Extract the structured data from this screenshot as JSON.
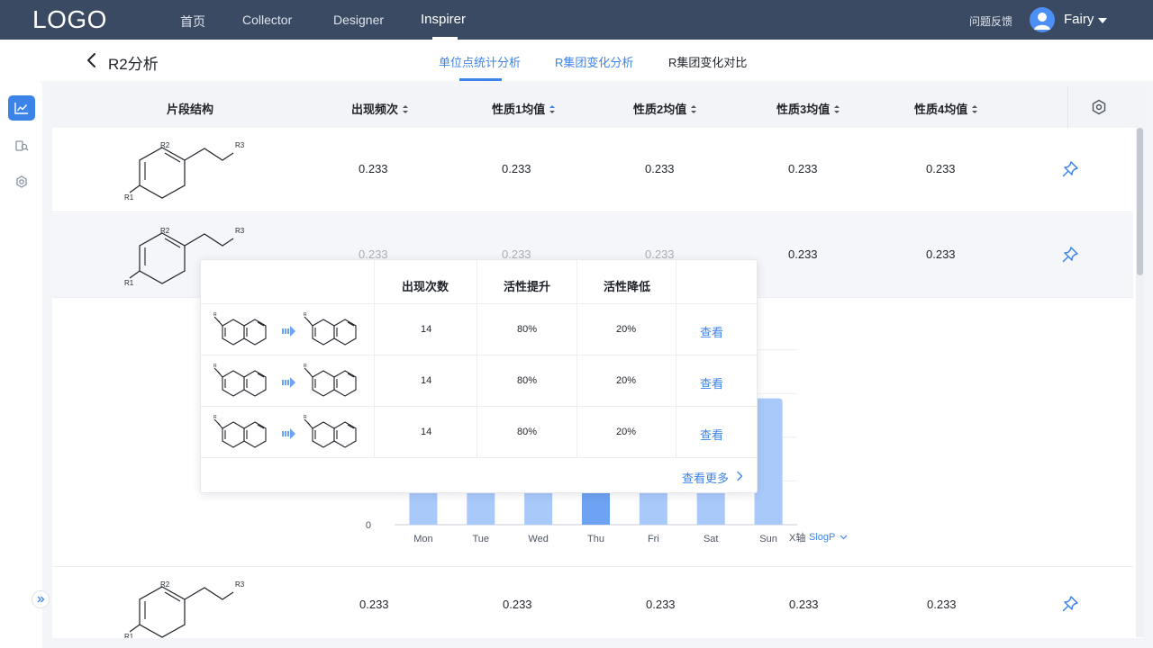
{
  "topnav": {
    "logo": "LOGO",
    "items": [
      "首页",
      "Collector",
      "Designer",
      "Inspirer"
    ],
    "active_index": 3,
    "feedback": "问题反馈",
    "user": "Fairy"
  },
  "subheader": {
    "title": "R2分析",
    "tabs": [
      "单位点统计分析",
      "R集团变化分析",
      "R集团变化对比"
    ],
    "active_tab": 0
  },
  "table": {
    "headers": [
      "片段结构",
      "出现频次",
      "性质1均值",
      "性质2均值",
      "性质3均值",
      "性质4均值"
    ],
    "rows": [
      {
        "structure_labels": [
          "R1",
          "R2",
          "R3"
        ],
        "values": [
          "0.233",
          "0.233",
          "0.233",
          "0.233",
          "0.233"
        ]
      },
      {
        "structure_labels": [
          "R1",
          "R2",
          "R3"
        ],
        "values": [
          "0.233",
          "0.233",
          "0.233",
          "0.233",
          "0.233"
        ]
      },
      {
        "structure_labels": [
          "R1",
          "R2",
          "R3"
        ],
        "values": [
          "0.233",
          "0.233",
          "0.233",
          "0.233",
          "0.233"
        ]
      }
    ]
  },
  "popup": {
    "headers": [
      "出现次数",
      "活性提升",
      "活性降低"
    ],
    "rows": [
      {
        "count": "14",
        "up": "80%",
        "down": "20%",
        "action": "查看"
      },
      {
        "count": "14",
        "up": "80%",
        "down": "20%",
        "action": "查看"
      },
      {
        "count": "14",
        "up": "80%",
        "down": "20%",
        "action": "查看"
      }
    ],
    "more": "查看更多"
  },
  "chart_data": {
    "type": "bar",
    "categories": [
      "Mon",
      "Tue",
      "Wed",
      "Thu",
      "Fri",
      "Sat",
      "Sun"
    ],
    "values": [
      420,
      390,
      360,
      120,
      390,
      400,
      260
    ],
    "ylim": [
      0,
      450
    ],
    "y_tick_label": "0",
    "x_axis_prefix": "X轴",
    "x_axis_selector": "SlogP",
    "highlight_index": 3,
    "colors": {
      "bar": "#a9c9fb",
      "bar_highlight": "#6ea2f3",
      "accent": "#3d84e8"
    }
  },
  "colors": {
    "nav_bg": "#3a4a62",
    "accent": "#3d84e8"
  }
}
